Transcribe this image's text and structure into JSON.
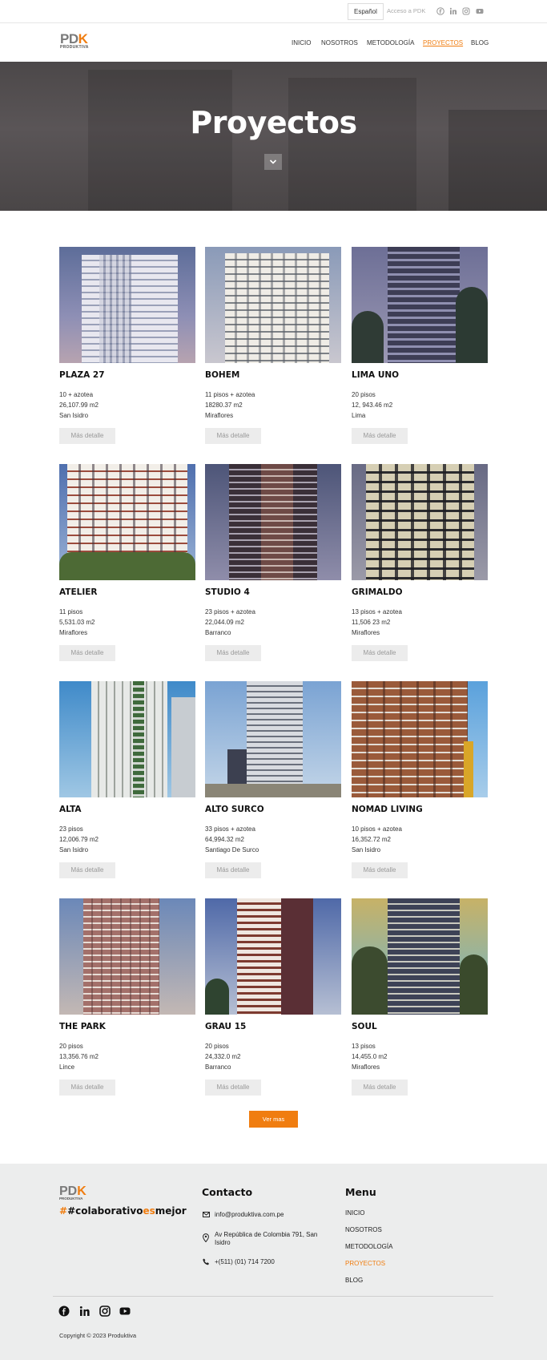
{
  "topbar": {
    "language": "Español",
    "access": "Acceso a PDK",
    "social_icons": [
      "facebook-icon",
      "linkedin-icon",
      "instagram-icon",
      "youtube-icon"
    ]
  },
  "header": {
    "logo_mark": "PDK",
    "logo_sub": "PRODUKTIVA",
    "nav": [
      {
        "label": "INICIO"
      },
      {
        "label": "NOSOTROS"
      },
      {
        "label": "METODOLOGÍA"
      },
      {
        "label": "PROYECTOS",
        "active": true
      },
      {
        "label": "BLOG"
      }
    ]
  },
  "hero": {
    "title": "Proyectos",
    "down_icon": "chevron-down-icon"
  },
  "projects": [
    {
      "name": "PLAZA 27",
      "floors": "10 + azotea",
      "area": "26,107.99 m2",
      "district": "San Isidro"
    },
    {
      "name": "BOHEM",
      "floors": "11 pisos + azotea",
      "area": "18280.37 m2",
      "district": "Miraflores"
    },
    {
      "name": "LIMA UNO",
      "floors": "20 pisos",
      "area": "12, 943.46 m2",
      "district": "Lima"
    },
    {
      "name": "ATELIER",
      "floors": "11 pisos",
      "area": "5,531.03 m2",
      "district": "Miraflores"
    },
    {
      "name": "STUDIO 4",
      "floors": "23 pisos + azotea",
      "area": "22,044.09 m2",
      "district": "Barranco"
    },
    {
      "name": "GRIMALDO",
      "floors": "13 pisos + azotea",
      "area": "11,506 23 m2",
      "district": "Miraflores"
    },
    {
      "name": "ALTA",
      "floors": "23 pisos",
      "area": "12,006.79 m2",
      "district": "San Isidro"
    },
    {
      "name": "ALTO SURCO",
      "floors": "33 pisos + azotea",
      "area": "64,994.32 m2",
      "district": "Santiago De Surco"
    },
    {
      "name": "NOMAD LIVING",
      "floors": "10 pisos + azotea",
      "area": "16,352.72 m2",
      "district": "San Isidro"
    },
    {
      "name": "THE PARK",
      "floors": "20 pisos",
      "area": "13,356.76 m2",
      "district": "Lince"
    },
    {
      "name": "GRAU 15",
      "floors": "20 pisos",
      "area": "24,332.0 m2",
      "district": "Barranco"
    },
    {
      "name": "SOUL",
      "floors": "13 pisos",
      "area": "14,455.0 m2",
      "district": "Miraflores"
    }
  ],
  "detail_label": "Más detalle",
  "ver_mas": "Ver mas",
  "footer": {
    "logo_mark": "PDK",
    "logo_sub": "PRODUKTIVA",
    "tag_1": "#colaborativo",
    "tag_2": "es",
    "tag_3": "mejor",
    "contact_title": "Contacto",
    "email": "info@produktiva.com.pe",
    "address": "Av República de Colombia 791, San Isidro",
    "phone": "+(511) (01) 714 7200",
    "menu_title": "Menu",
    "menu": [
      "INICIO",
      "NOSOTROS",
      "METODOLOGÍA",
      "PROYECTOS",
      "BLOG"
    ],
    "copyright": "Copyright © 2023 Produktiva"
  },
  "colors": {
    "accent": "#f07d10",
    "hero": "#4f4b4c",
    "footer_bg": "#eceded"
  }
}
